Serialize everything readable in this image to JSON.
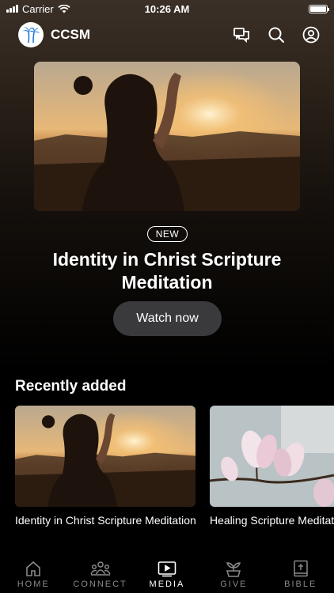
{
  "status": {
    "carrier": "Carrier",
    "time": "10:26 AM"
  },
  "header": {
    "brand": "CCSM"
  },
  "hero": {
    "badge": "NEW",
    "title": "Identity in Christ Scripture Meditation",
    "button": "Watch now"
  },
  "recent": {
    "heading": "Recently added",
    "items": [
      {
        "title": "Identity in Christ Scripture Meditation"
      },
      {
        "title": "Healing Scripture Meditation"
      }
    ]
  },
  "tabs": [
    {
      "label": "HOME",
      "icon": "home-icon",
      "active": false
    },
    {
      "label": "CONNECT",
      "icon": "people-icon",
      "active": false
    },
    {
      "label": "MEDIA",
      "icon": "play-icon",
      "active": true
    },
    {
      "label": "GIVE",
      "icon": "sprout-icon",
      "active": false
    },
    {
      "label": "BIBLE",
      "icon": "bible-icon",
      "active": false
    }
  ],
  "colors": {
    "accent": "#ffffff",
    "inactive": "#8a8a8a",
    "button": "#3a3a3c"
  }
}
